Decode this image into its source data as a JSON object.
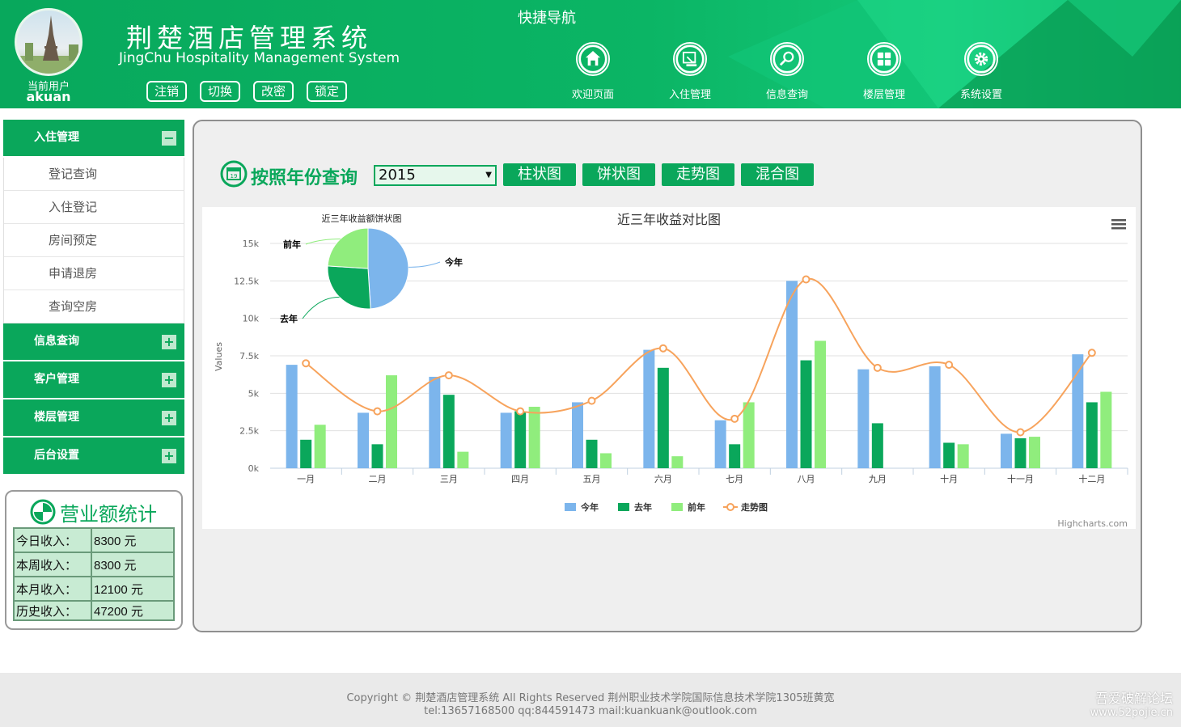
{
  "header": {
    "title": "荆楚酒店管理系统",
    "subtitle": "JingChu Hospitality Management System",
    "current_user_label": "当前用户",
    "current_user_name": "akuan",
    "buttons": [
      "注销",
      "切换",
      "改密",
      "锁定"
    ],
    "quick_nav_title": "快捷导航",
    "nav": [
      {
        "label": "欢迎页面",
        "icon": "home-icon"
      },
      {
        "label": "入住管理",
        "icon": "checkin-icon"
      },
      {
        "label": "信息查询",
        "icon": "search-icon"
      },
      {
        "label": "楼层管理",
        "icon": "grid-icon"
      },
      {
        "label": "系统设置",
        "icon": "gear-icon"
      }
    ]
  },
  "sidebar": {
    "groups": [
      {
        "label": "入住管理",
        "expanded": true,
        "items": [
          "登记查询",
          "入住登记",
          "房间预定",
          "申请退房",
          "查询空房"
        ]
      },
      {
        "label": "信息查询",
        "expanded": false,
        "items": []
      },
      {
        "label": "客户管理",
        "expanded": false,
        "items": []
      },
      {
        "label": "楼层管理",
        "expanded": false,
        "items": []
      },
      {
        "label": "后台设置",
        "expanded": false,
        "items": []
      }
    ],
    "toggle_minus": "−",
    "toggle_plus": "+"
  },
  "stats": {
    "title": "营业额统计",
    "rows": [
      {
        "label": "今日收入：",
        "value": "8300 元"
      },
      {
        "label": "本周收入：",
        "value": "8300 元"
      },
      {
        "label": "本月收入：",
        "value": "12100 元"
      },
      {
        "label": "历史收入：",
        "value": "47200 元"
      }
    ]
  },
  "query": {
    "title": "按照年份查询",
    "selected_year": "2015",
    "buttons": [
      "柱状图",
      "饼状图",
      "走势图",
      "混合图"
    ]
  },
  "colors": {
    "brand": "#0aa75b",
    "this_year": "#7cb5ec",
    "last_year": "#0aa75b",
    "year_before": "#90ed7d",
    "trend": "#f7a35c"
  },
  "chart_data": {
    "type": "bar",
    "title": "近三年收益对比图",
    "ylabel": "Values",
    "ylim": [
      0,
      15000
    ],
    "yticks": [
      "0k",
      "2.5k",
      "5k",
      "7.5k",
      "10k",
      "12.5k",
      "15k"
    ],
    "categories": [
      "一月",
      "二月",
      "三月",
      "四月",
      "五月",
      "六月",
      "七月",
      "八月",
      "九月",
      "十月",
      "十一月",
      "十二月"
    ],
    "series": [
      {
        "name": "今年",
        "type": "column",
        "values": [
          6900,
          3700,
          6100,
          3700,
          4400,
          7900,
          3200,
          12500,
          6600,
          6800,
          2300,
          7600
        ]
      },
      {
        "name": "去年",
        "type": "column",
        "values": [
          1900,
          1600,
          4900,
          3800,
          1900,
          6700,
          1600,
          7200,
          3000,
          1700,
          2000,
          4400
        ]
      },
      {
        "name": "前年",
        "type": "column",
        "values": [
          2900,
          6200,
          1100,
          4100,
          1000,
          800,
          4400,
          8500,
          0,
          1600,
          2100,
          5100
        ]
      },
      {
        "name": "走势图",
        "type": "spline",
        "values": [
          7000,
          3800,
          6200,
          3800,
          4500,
          8000,
          3300,
          12600,
          6700,
          6900,
          2400,
          7700
        ]
      }
    ],
    "pie": {
      "title": "近三年收益额饼状图",
      "slices": [
        {
          "name": "今年",
          "value": 49
        },
        {
          "name": "去年",
          "value": 27
        },
        {
          "name": "前年",
          "value": 24
        }
      ]
    },
    "credit": "Highcharts.com",
    "legend_position": "bottom-center"
  },
  "footer": {
    "line1": "Copyright © 荆楚酒店管理系统 All Rights Reserved 荆州职业技术学院国际信息技术学院1305班黄宽",
    "line2": "tel:13657168500    qq:844591473    mail:kuankuank@outlook.com",
    "watermark1": "吾爱破解论坛",
    "watermark2": "www.52pojie.cn"
  }
}
